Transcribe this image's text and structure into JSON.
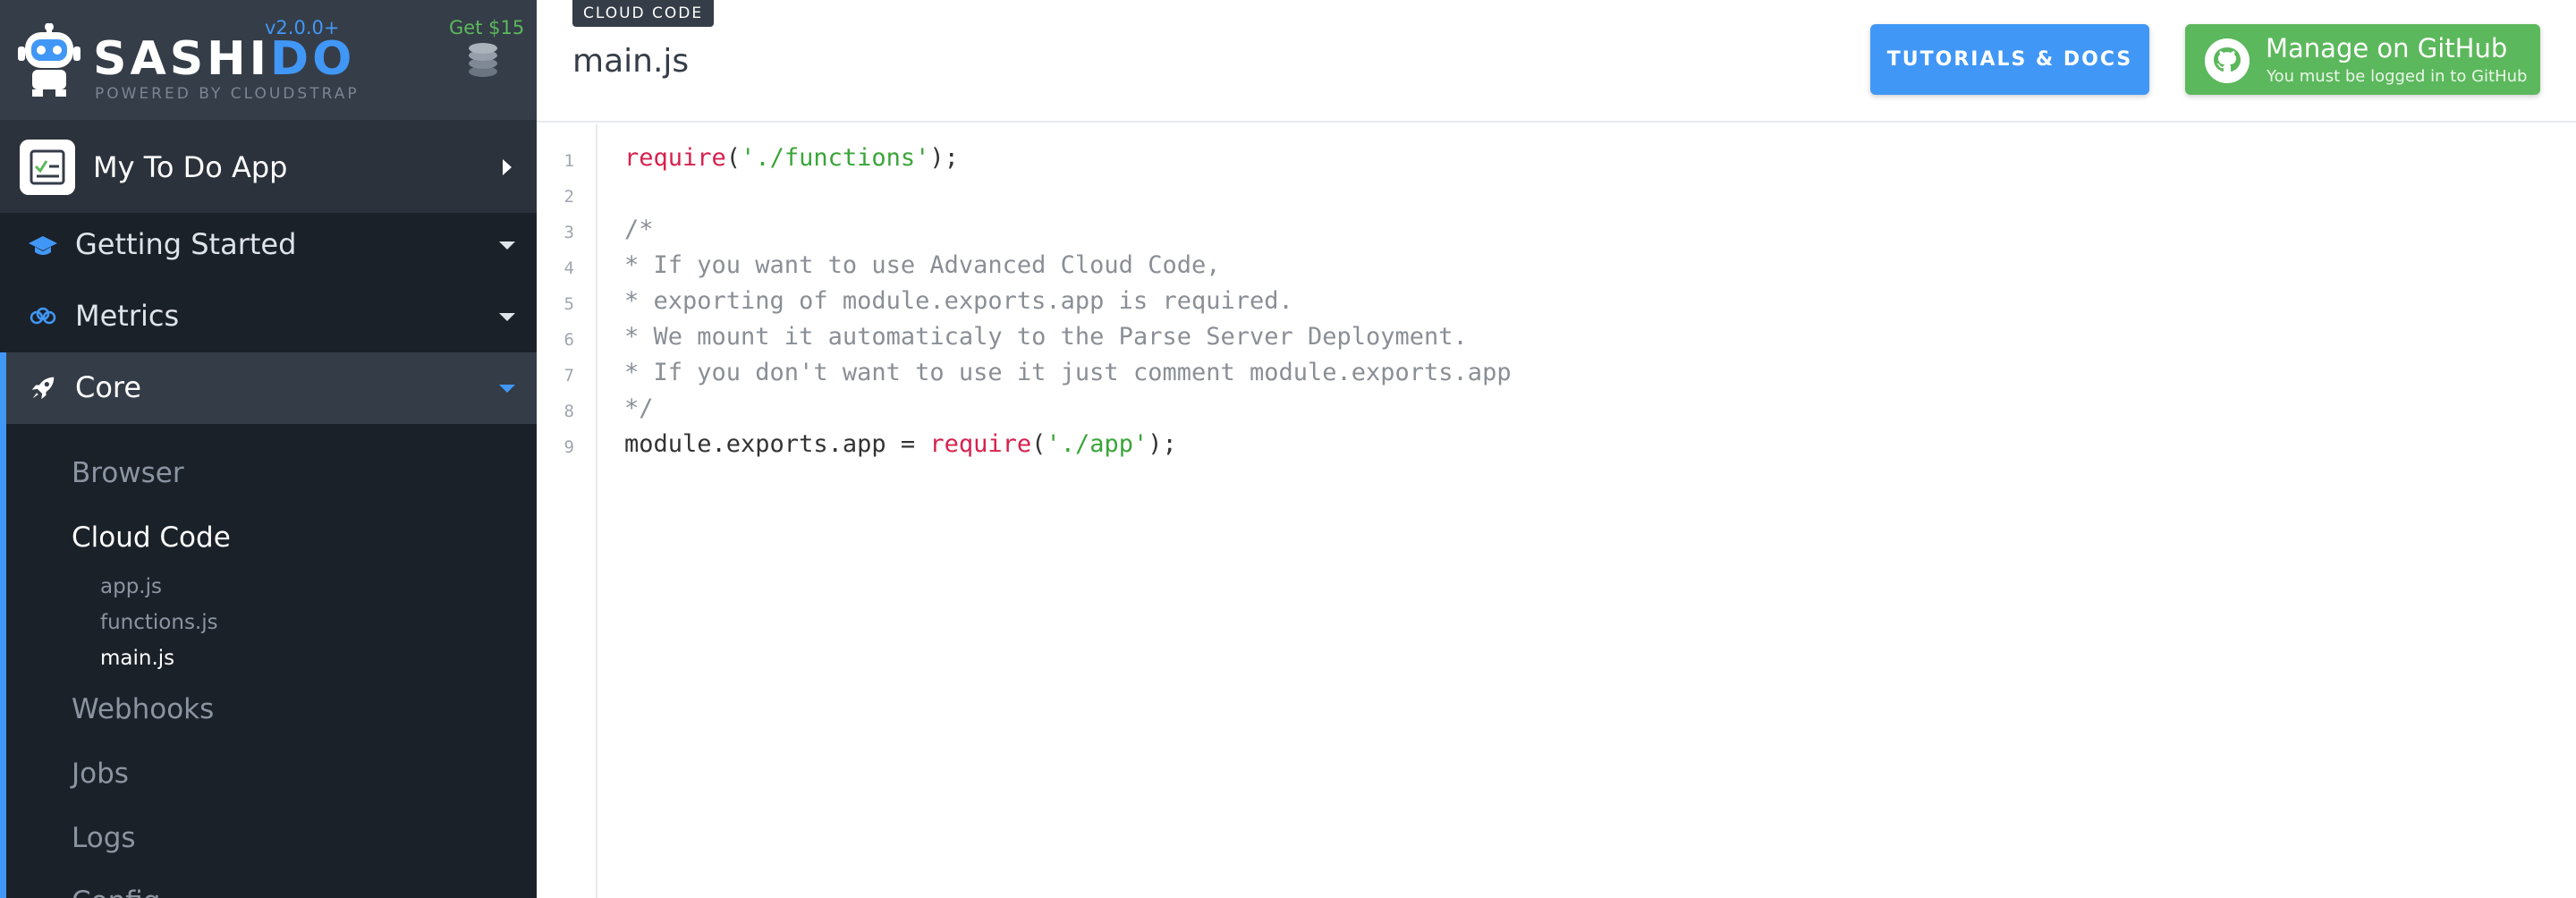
{
  "sidebar": {
    "brand_a": "SASHI",
    "brand_b": "DO",
    "powered_by": "POWERED BY CLOUDSTRAP",
    "version": "v2.0.0+",
    "promo": "Get $15",
    "app_name": "My To Do App",
    "nav": [
      {
        "label": "Getting Started",
        "icon": "graduation-cap-icon"
      },
      {
        "label": "Metrics",
        "icon": "metrics-icon"
      },
      {
        "label": "Core",
        "icon": "rocket-icon"
      }
    ],
    "core_items": [
      {
        "label": "Browser"
      },
      {
        "label": "Cloud Code"
      },
      {
        "label": "Webhooks"
      },
      {
        "label": "Jobs"
      },
      {
        "label": "Logs"
      },
      {
        "label": "Config"
      }
    ],
    "files": [
      {
        "label": "app.js"
      },
      {
        "label": "functions.js"
      },
      {
        "label": "main.js"
      }
    ]
  },
  "header": {
    "section_badge": "CLOUD CODE",
    "title": "main.js",
    "docs_button": "TUTORIALS & DOCS",
    "github_button": "Manage on GitHub",
    "github_note": "You must be logged in to GitHub"
  },
  "editor": {
    "line_numbers": [
      "1",
      "2",
      "3",
      "4",
      "5",
      "6",
      "7",
      "8",
      "9"
    ],
    "l1_fn": "require",
    "l1_open": "(",
    "l1_str": "'./functions'",
    "l1_close": ");",
    "l3": "/*",
    "l4": "* If you want to use Advanced Cloud Code,",
    "l5": "* exporting of module.exports.app is required.",
    "l6": "* We mount it automaticaly to the Parse Server Deployment.",
    "l7": "* If you don't want to use it just comment module.exports.app",
    "l8": "*/",
    "l9_a": "module.exports.app = ",
    "l9_fn": "require",
    "l9_open": "(",
    "l9_str": "'./app'",
    "l9_close": ");"
  }
}
